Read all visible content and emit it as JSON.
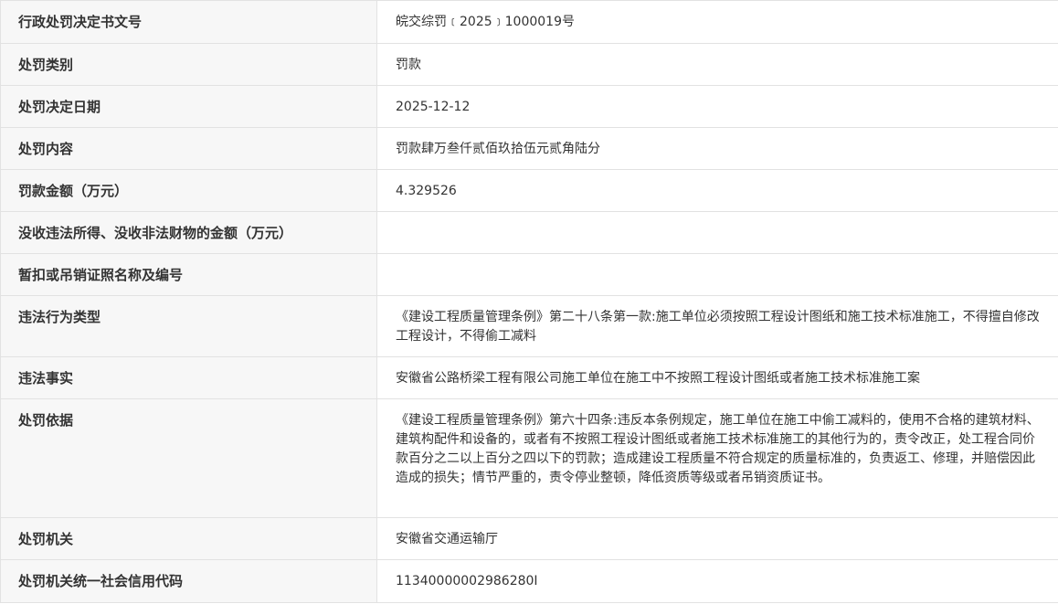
{
  "rows": [
    {
      "label": "行政处罚决定书文号",
      "value": "皖交综罚﹝2025﹞1000019号"
    },
    {
      "label": "处罚类别",
      "value": "罚款"
    },
    {
      "label": "处罚决定日期",
      "value": "2025-12-12"
    },
    {
      "label": "处罚内容",
      "value": "罚款肆万叁仟贰佰玖拾伍元贰角陆分"
    },
    {
      "label": "罚款金额（万元）",
      "value": "4.329526"
    },
    {
      "label": "没收违法所得、没收非法财物的金额（万元）",
      "value": ""
    },
    {
      "label": "暂扣或吊销证照名称及编号",
      "value": ""
    },
    {
      "label": "违法行为类型",
      "value": "《建设工程质量管理条例》第二十八条第一款:施工单位必须按照工程设计图纸和施工技术标准施工，不得擅自修改工程设计，不得偷工减料"
    },
    {
      "label": "违法事实",
      "value": "安徽省公路桥梁工程有限公司施工单位在施工中不按照工程设计图纸或者施工技术标准施工案"
    },
    {
      "label": "处罚依据",
      "value": "《建设工程质量管理条例》第六十四条:违反本条例规定，施工单位在施工中偷工减料的，使用不合格的建筑材料、建筑构配件和设备的，或者有不按照工程设计图纸或者施工技术标准施工的其他行为的，责令改正，处工程合同价款百分之二以上百分之四以下的罚款；造成建设工程质量不符合规定的质量标准的，负责返工、修理，并赔偿因此造成的损失；情节严重的，责令停业整顿，降低资质等级或者吊销资质证书。"
    },
    {
      "label": "处罚机关",
      "value": "安徽省交通运输厅"
    },
    {
      "label": "处罚机关统一社会信用代码",
      "value": "11340000002986280I"
    }
  ]
}
